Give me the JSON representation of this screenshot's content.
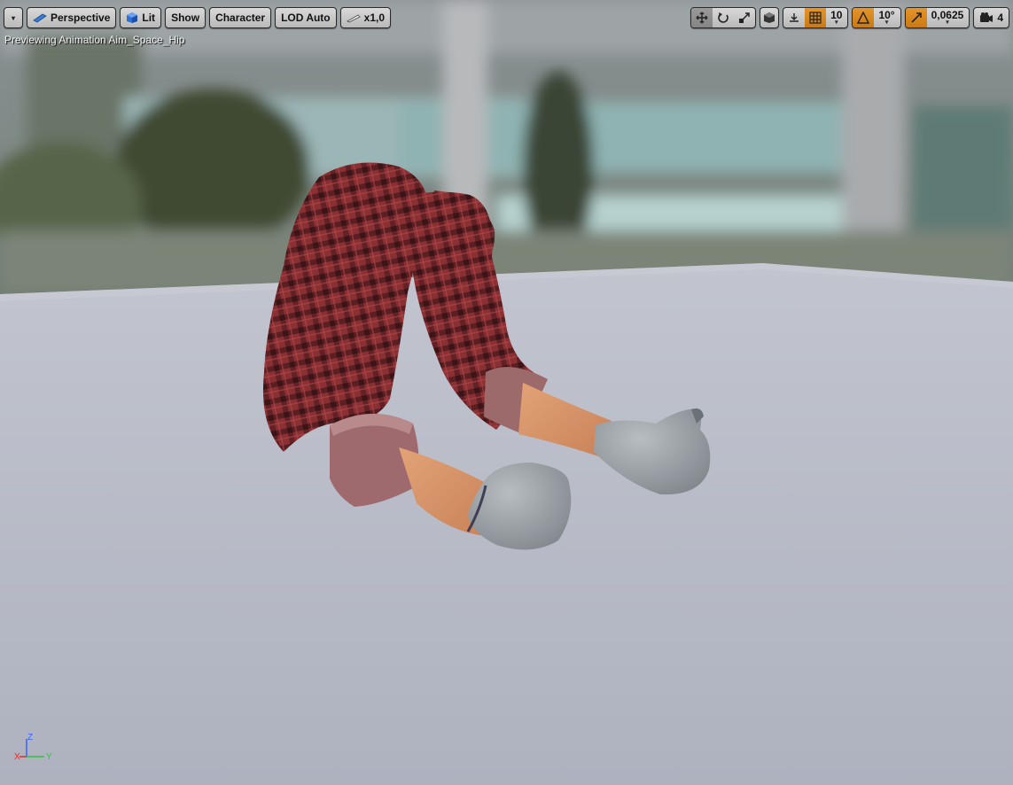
{
  "toolbar_left": {
    "options_label": "▾",
    "perspective_label": "Perspective",
    "lit_label": "Lit",
    "show_label": "Show",
    "character_label": "Character",
    "lod_label": "LOD Auto",
    "speed_label": "x1,0"
  },
  "toolbar_right": {
    "grid_snap_value": "10",
    "rotation_snap_value": "10°",
    "scale_snap_value": "0,0625",
    "camera_speed_value": "4"
  },
  "viewport": {
    "preview_text": "Previewing Animation Aim_Space_Hip"
  },
  "axis": {
    "z": "Z",
    "x": "X",
    "y": "Y"
  },
  "colors": {
    "snap_active": "#e6952a",
    "floor": "#b8bcc8",
    "sleeve": "#8e3a3c",
    "glove": "#9da3a8"
  }
}
